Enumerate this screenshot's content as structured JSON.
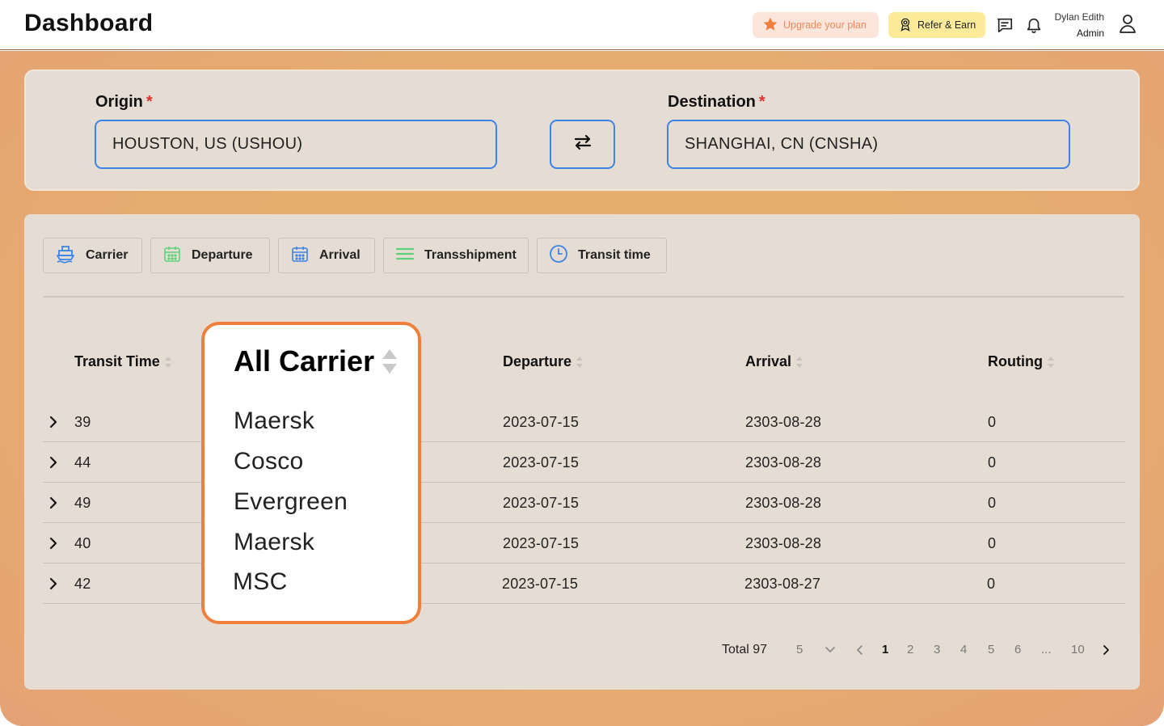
{
  "header": {
    "title": "Dashboard",
    "upgrade_label": "Upgrade your plan",
    "refer_label": "Refer & Earn",
    "user_name": "Dylan Edith",
    "user_role": "Admin",
    "icons": [
      "star-icon",
      "award-icon",
      "message-icon",
      "bell-icon",
      "user-icon"
    ]
  },
  "route": {
    "origin_label": "Origin",
    "origin_value": "HOUSTON, US (USHOU)",
    "destination_label": "Destination",
    "destination_value": "SHANGHAI, CN (CNSHA)",
    "required_mark": "*"
  },
  "filters": [
    {
      "label": "Carrier",
      "icon": "ship-icon"
    },
    {
      "label": "Departure",
      "icon": "calendar-icon"
    },
    {
      "label": "Arrival",
      "icon": "calendar-icon"
    },
    {
      "label": "Transshipment",
      "icon": "list-icon"
    },
    {
      "label": "Transit time",
      "icon": "clock-icon"
    }
  ],
  "table": {
    "columns": [
      "Transit Time",
      "Departure",
      "Arrival",
      "Routing"
    ],
    "rows": [
      {
        "transit": "39",
        "departure": "2023-07-15",
        "arrival": "2303-08-28",
        "routing": "0"
      },
      {
        "transit": "44",
        "departure": "2023-07-15",
        "arrival": "2303-08-28",
        "routing": "0"
      },
      {
        "transit": "49",
        "departure": "2023-07-15",
        "arrival": "2303-08-28",
        "routing": "0"
      },
      {
        "transit": "40",
        "departure": "2023-07-15",
        "arrival": "2303-08-28",
        "routing": "0"
      },
      {
        "transit": "42",
        "departure": "2023-07-15",
        "arrival": "2303-08-27",
        "routing": "0"
      }
    ]
  },
  "carrier_dropdown": {
    "title": "All Carrier",
    "items": [
      "Maersk",
      "Cosco",
      "Evergreen",
      "Maersk",
      "MSC"
    ]
  },
  "pagination": {
    "total_label": "Total 97",
    "page_size": "5",
    "pages": [
      "1",
      "2",
      "3",
      "4",
      "5",
      "6",
      "...",
      "10"
    ],
    "current": "1"
  },
  "colors": {
    "accent_blue": "#3c84e8",
    "dropdown_border": "#f07f3c",
    "upgrade_text": "#f08a5a",
    "refer_bg": "#fdeb9a"
  }
}
